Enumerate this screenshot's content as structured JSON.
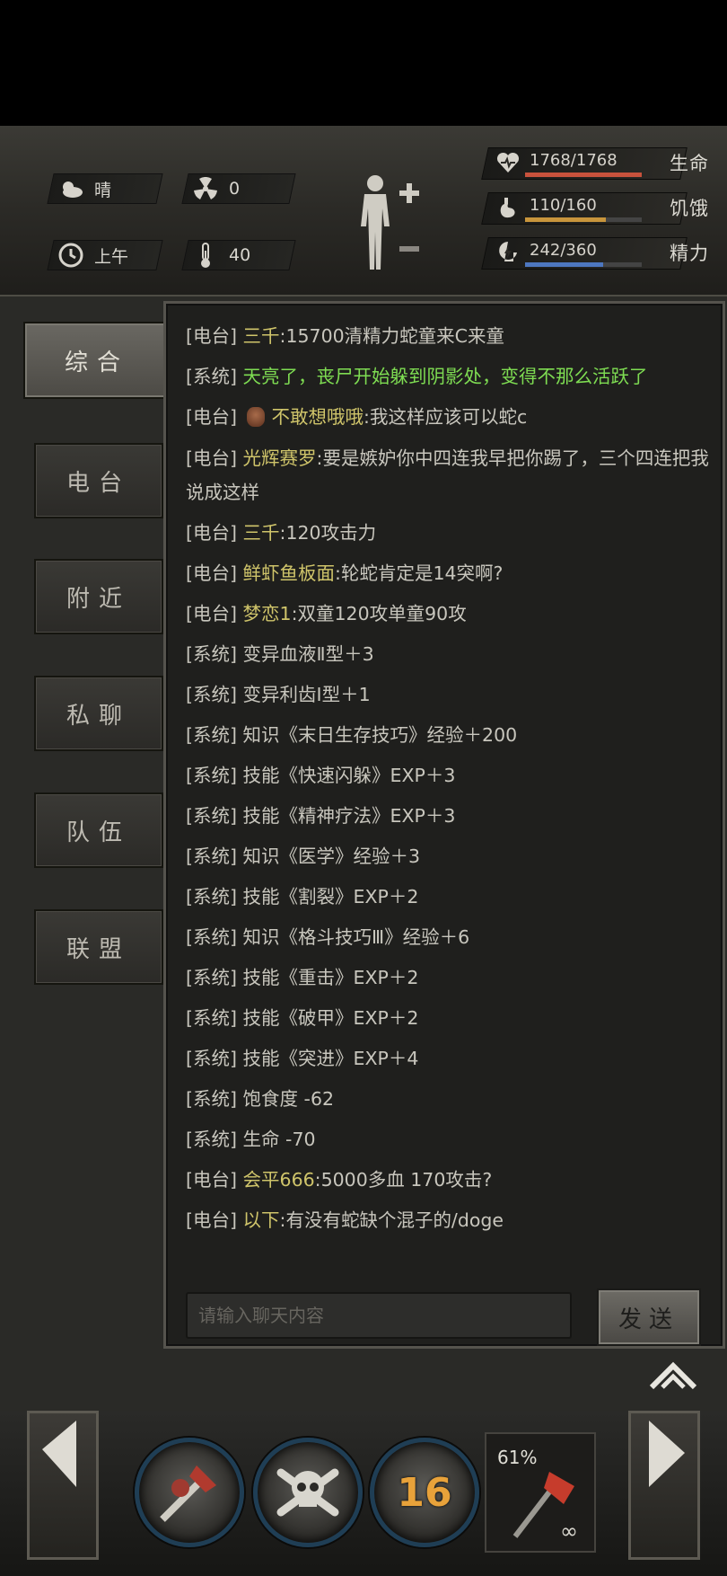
{
  "status": {
    "weather": "晴",
    "radiation": "0",
    "time_of_day": "上午",
    "temperature": "40"
  },
  "vitals": [
    {
      "value": "1768/1768",
      "name": "生命",
      "fill": 1.0,
      "color": "#c8523c",
      "icon": "heart-icon"
    },
    {
      "value": "110/160",
      "name": "饥饿",
      "fill": 0.69,
      "color": "#c8953c",
      "icon": "stomach-icon"
    },
    {
      "value": "242/360",
      "name": "精力",
      "fill": 0.67,
      "color": "#4d77c0",
      "icon": "energy-icon"
    }
  ],
  "tabs": [
    {
      "label": "综合",
      "active": true
    },
    {
      "label": "电台",
      "active": false
    },
    {
      "label": "附近",
      "active": false
    },
    {
      "label": "私聊",
      "active": false
    },
    {
      "label": "队伍",
      "active": false
    },
    {
      "label": "联盟",
      "active": false
    }
  ],
  "chat": {
    "messages": [
      {
        "channel": "[电台]",
        "user": "三千",
        "text": ":15700清精力蛇童来C来童"
      },
      {
        "channel": "[系统]",
        "text": "天亮了，丧尸开始躲到阴影处，变得不那么活跃了",
        "green": true
      },
      {
        "channel": "[电台]",
        "user": "不敢想哦哦",
        "text": ":我这样应该可以蛇c",
        "avatar": true
      },
      {
        "channel": "[电台]",
        "user": "光辉赛罗",
        "text": ":要是嫉妒你中四连我早把你踢了，三个四连把我说成这样",
        "wrap": true
      },
      {
        "channel": "[电台]",
        "user": "三千",
        "text": ":120攻击力"
      },
      {
        "channel": "[电台]",
        "user": "鲜虾鱼板面",
        "text": ":轮蛇肯定是14突啊?"
      },
      {
        "channel": "[电台]",
        "user": "梦恋1",
        "text": ":双童120攻单童90攻"
      },
      {
        "channel": "[系统]",
        "text": "变异血液Ⅱ型＋3"
      },
      {
        "channel": "[系统]",
        "text": "变异利齿Ⅰ型＋1"
      },
      {
        "channel": "[系统]",
        "text": "知识《末日生存技巧》经验＋200"
      },
      {
        "channel": "[系统]",
        "text": "技能《快速闪躲》EXP＋3"
      },
      {
        "channel": "[系统]",
        "text": "技能《精神疗法》EXP＋3"
      },
      {
        "channel": "[系统]",
        "text": "知识《医学》经验＋3"
      },
      {
        "channel": "[系统]",
        "text": "技能《割裂》EXP＋2"
      },
      {
        "channel": "[系统]",
        "text": "知识《格斗技巧Ⅲ》经验＋6"
      },
      {
        "channel": "[系统]",
        "text": "技能《重击》EXP＋2"
      },
      {
        "channel": "[系统]",
        "text": "技能《破甲》EXP＋2"
      },
      {
        "channel": "[系统]",
        "text": "技能《突进》EXP＋4"
      },
      {
        "channel": "[系统]",
        "text": "饱食度 -62"
      },
      {
        "channel": "[系统]",
        "text": "生命 -70"
      },
      {
        "channel": "[电台]",
        "user": "会平666",
        "text": ":5000多血 170攻击?"
      },
      {
        "channel": "[电台]",
        "user": "以下",
        "text": ":有没有蛇缺个混子的/doge"
      }
    ],
    "input_placeholder": "请输入聊天内容",
    "send_label": "发送"
  },
  "hotbar": {
    "combo_count": "16",
    "weapon_durability": "61%",
    "weapon_count": "∞"
  },
  "colors": {
    "accent_user": "#cfc46a",
    "system_green": "#7edc52",
    "panel_bg": "#1f1f1d"
  }
}
